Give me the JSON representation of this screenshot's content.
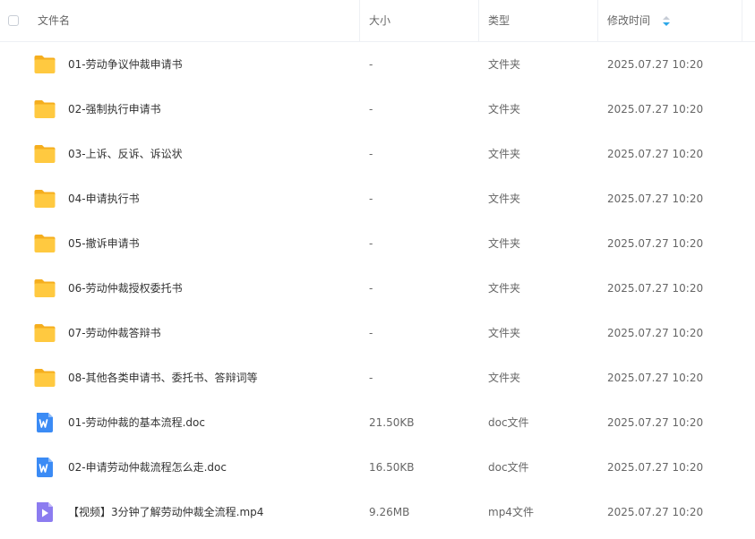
{
  "columns": {
    "name": "文件名",
    "size": "大小",
    "type": "类型",
    "modified": "修改时间"
  },
  "rows": [
    {
      "icon": "folder-icon",
      "name": "01-劳动争议仲裁申请书",
      "size": "-",
      "type": "文件夹",
      "modified": "2025.07.27 10:20"
    },
    {
      "icon": "folder-icon",
      "name": "02-强制执行申请书",
      "size": "-",
      "type": "文件夹",
      "modified": "2025.07.27 10:20"
    },
    {
      "icon": "folder-icon",
      "name": "03-上诉、反诉、诉讼状",
      "size": "-",
      "type": "文件夹",
      "modified": "2025.07.27 10:20"
    },
    {
      "icon": "folder-icon",
      "name": "04-申请执行书",
      "size": "-",
      "type": "文件夹",
      "modified": "2025.07.27 10:20"
    },
    {
      "icon": "folder-icon",
      "name": "05-撤诉申请书",
      "size": "-",
      "type": "文件夹",
      "modified": "2025.07.27 10:20"
    },
    {
      "icon": "folder-icon",
      "name": "06-劳动仲裁授权委托书",
      "size": "-",
      "type": "文件夹",
      "modified": "2025.07.27 10:20"
    },
    {
      "icon": "folder-icon",
      "name": "07-劳动仲裁答辩书",
      "size": "-",
      "type": "文件夹",
      "modified": "2025.07.27 10:20"
    },
    {
      "icon": "folder-icon",
      "name": "08-其他各类申请书、委托书、答辩词等",
      "size": "-",
      "type": "文件夹",
      "modified": "2025.07.27 10:20"
    },
    {
      "icon": "word-doc-icon",
      "name": "01-劳动仲裁的基本流程.doc",
      "size": "21.50KB",
      "type": "doc文件",
      "modified": "2025.07.27 10:20"
    },
    {
      "icon": "word-doc-icon",
      "name": "02-申请劳动仲裁流程怎么走.doc",
      "size": "16.50KB",
      "type": "doc文件",
      "modified": "2025.07.27 10:20"
    },
    {
      "icon": "video-file-icon",
      "name": "【视频】3分钟了解劳动仲裁全流程.mp4",
      "size": "9.26MB",
      "type": "mp4文件",
      "modified": "2025.07.27 10:20"
    }
  ],
  "colors": {
    "folder": "#FFC53D",
    "doc": "#3B8BF5",
    "video": "#8C7CF0",
    "sort_accent": "#2DA8E8"
  }
}
